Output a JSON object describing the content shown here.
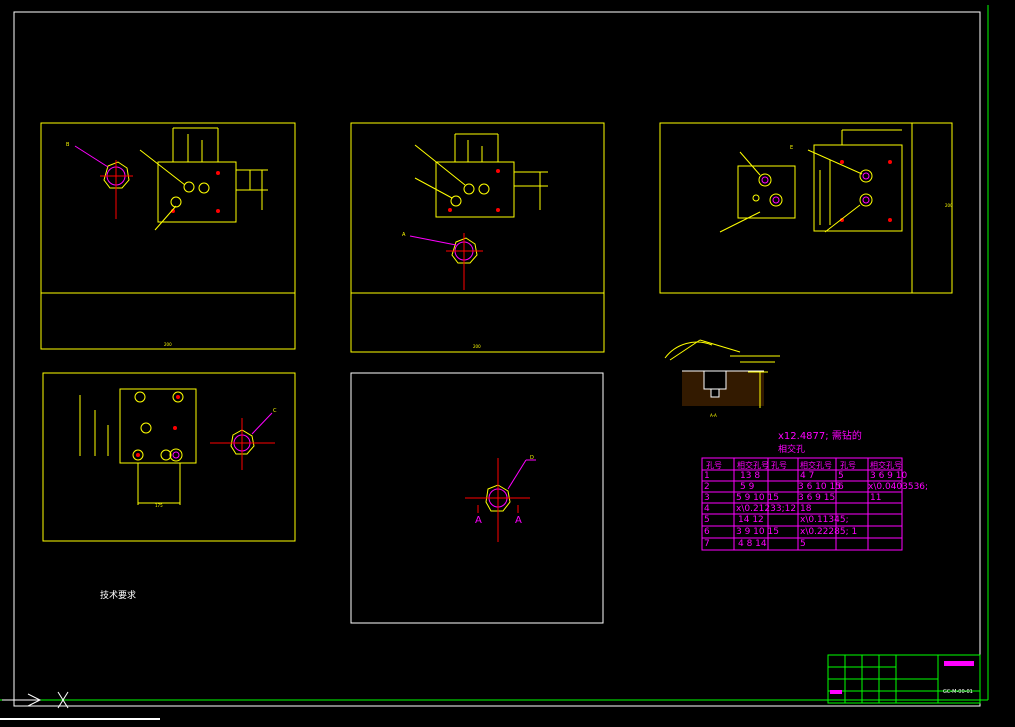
{
  "drawing": {
    "tech_title": "技术要求",
    "hole_table": {
      "title_line1": "x12.4877; 需钻的",
      "title_line2": "相交孔",
      "headers": [
        "孔号",
        "相交孔号",
        "孔号",
        "相交孔号",
        "孔号",
        "相交孔号"
      ],
      "rows": [
        [
          "1",
          "13    8",
          "4  7",
          "5",
          "3  6  9  10",
          ""
        ],
        [
          "2",
          "5      9",
          "3  6  10 15",
          "6",
          "x\\0.0403536;",
          ""
        ],
        [
          "3",
          "5  9  10  15",
          "3  6  9  15",
          "",
          "11",
          ""
        ],
        [
          "4",
          "x\\0.21233;12",
          "18",
          "",
          "",
          ""
        ],
        [
          "5",
          "14     12",
          "x\\0.11345;",
          "",
          "",
          ""
        ],
        [
          "6",
          "3  9  10  15",
          "x\\0.22285;  1",
          "",
          "",
          ""
        ],
        [
          "7",
          "4  8     14",
          "5",
          "",
          "",
          ""
        ]
      ]
    },
    "section_labels": {
      "a_left": "A",
      "a_right": "A",
      "aa_note": "A-A"
    },
    "title_block_code": "GC-M-00-01",
    "dimension_tags": {
      "v1_label": "B",
      "v2_label": "A",
      "v3_label": "E",
      "v4_label": "C",
      "v5_label": "D",
      "view1_bottom": "200",
      "view2_bottom": "200",
      "view3_side": "200",
      "view4_bottom": "175"
    }
  }
}
